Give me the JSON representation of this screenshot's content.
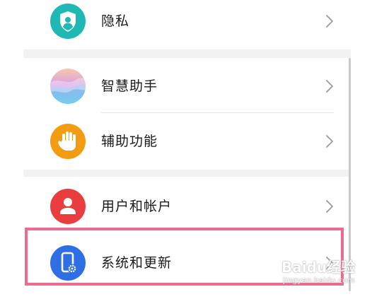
{
  "settings_list": {
    "items": [
      {
        "label": "隐私",
        "icon": "privacy-shield-icon",
        "color": "#1fb8b3"
      },
      {
        "label": "智慧助手",
        "icon": "smart-assistant-icon",
        "color": "#c58de0"
      },
      {
        "label": "辅助功能",
        "icon": "hand-icon",
        "color": "#f39c12"
      },
      {
        "label": "用户和帐户",
        "icon": "user-icon",
        "color": "#ea3d3d"
      },
      {
        "label": "系统和更新",
        "icon": "phone-gear-icon",
        "color": "#2f6fe6"
      }
    ]
  },
  "highlight": {
    "color": "#ee6a8e"
  },
  "watermark": {
    "brand": "Baidu经验",
    "url": "jingyan.baidu.com"
  }
}
